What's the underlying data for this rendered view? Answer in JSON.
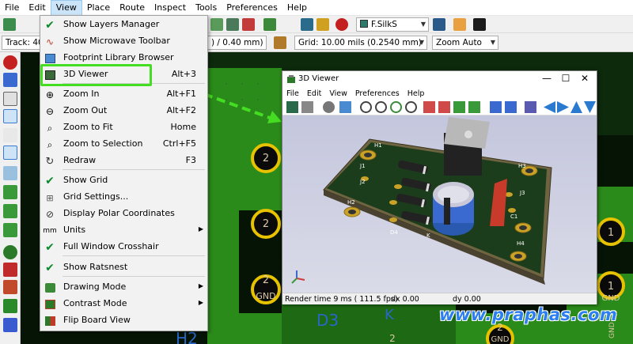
{
  "menubar": {
    "items": [
      "File",
      "Edit",
      "View",
      "Place",
      "Route",
      "Inspect",
      "Tools",
      "Preferences",
      "Help"
    ],
    "active": "View"
  },
  "toolbar": {
    "track_label": "Track: 40.0",
    "via_label": ") / 0.40 mm) *",
    "layer_label": "F.SilkS",
    "grid_label": "Grid: 10.00 mils (0.2540 mm)",
    "zoom_label": "Zoom Auto"
  },
  "view_menu": {
    "items": [
      {
        "label": "Show Layers Manager",
        "shortcut": "",
        "icon": "check-icon",
        "submenu": false
      },
      {
        "label": "Show Microwave Toolbar",
        "shortcut": "",
        "icon": "microwave-icon",
        "submenu": false
      },
      {
        "label": "Footprint Library Browser",
        "shortcut": "",
        "icon": "library-icon",
        "submenu": false
      },
      {
        "label": "3D Viewer",
        "shortcut": "Alt+3",
        "icon": "3d-viewer-icon",
        "submenu": false
      },
      {
        "label": "Zoom In",
        "shortcut": "Alt+F1",
        "icon": "zoom-in-icon",
        "submenu": false
      },
      {
        "label": "Zoom Out",
        "shortcut": "Alt+F2",
        "icon": "zoom-out-icon",
        "submenu": false
      },
      {
        "label": "Zoom to Fit",
        "shortcut": "Home",
        "icon": "zoom-fit-icon",
        "submenu": false
      },
      {
        "label": "Zoom to Selection",
        "shortcut": "Ctrl+F5",
        "icon": "zoom-selection-icon",
        "submenu": false
      },
      {
        "label": "Redraw",
        "shortcut": "F3",
        "icon": "redraw-icon",
        "submenu": false
      },
      {
        "label": "Show Grid",
        "shortcut": "",
        "icon": "check-icon",
        "submenu": false
      },
      {
        "label": "Grid Settings...",
        "shortcut": "",
        "icon": "grid-icon",
        "submenu": false
      },
      {
        "label": "Display Polar Coordinates",
        "shortcut": "",
        "icon": "polar-icon",
        "submenu": false
      },
      {
        "label": "Units",
        "shortcut": "",
        "icon": "units-icon",
        "submenu": true
      },
      {
        "label": "Full Window Crosshair",
        "shortcut": "",
        "icon": "check-icon",
        "submenu": false
      },
      {
        "label": "Show Ratsnest",
        "shortcut": "",
        "icon": "check-icon",
        "submenu": false
      },
      {
        "label": "Drawing Mode",
        "shortcut": "",
        "icon": "drawing-mode-icon",
        "submenu": true
      },
      {
        "label": "Contrast Mode",
        "shortcut": "",
        "icon": "contrast-icon",
        "submenu": true
      },
      {
        "label": "Flip Board View",
        "shortcut": "",
        "icon": "flip-board-icon",
        "submenu": false
      }
    ]
  },
  "viewer": {
    "title": "3D Viewer",
    "menu": [
      "File",
      "Edit",
      "View",
      "Preferences",
      "Help"
    ],
    "status": {
      "render": "Render time 9 ms ( 111.5 fps)",
      "dx": "dx 0.00",
      "dy": "dy 0.00"
    },
    "board_labels": [
      "H1",
      "H2",
      "H3",
      "H4",
      "J1",
      "J2",
      "J3",
      "D4",
      "K",
      "C1"
    ]
  },
  "pcb": {
    "labels": [
      "2",
      "2",
      "2",
      "GND",
      "2",
      "D3",
      "K",
      "H2",
      "GND",
      "1",
      "1",
      "2",
      "GND",
      "2"
    ]
  },
  "watermark": "www.praphas.com",
  "colors": {
    "accent_green": "#44dd22",
    "pcb_green": "#2a8a2a",
    "pad_yellow": "#e6c200"
  }
}
